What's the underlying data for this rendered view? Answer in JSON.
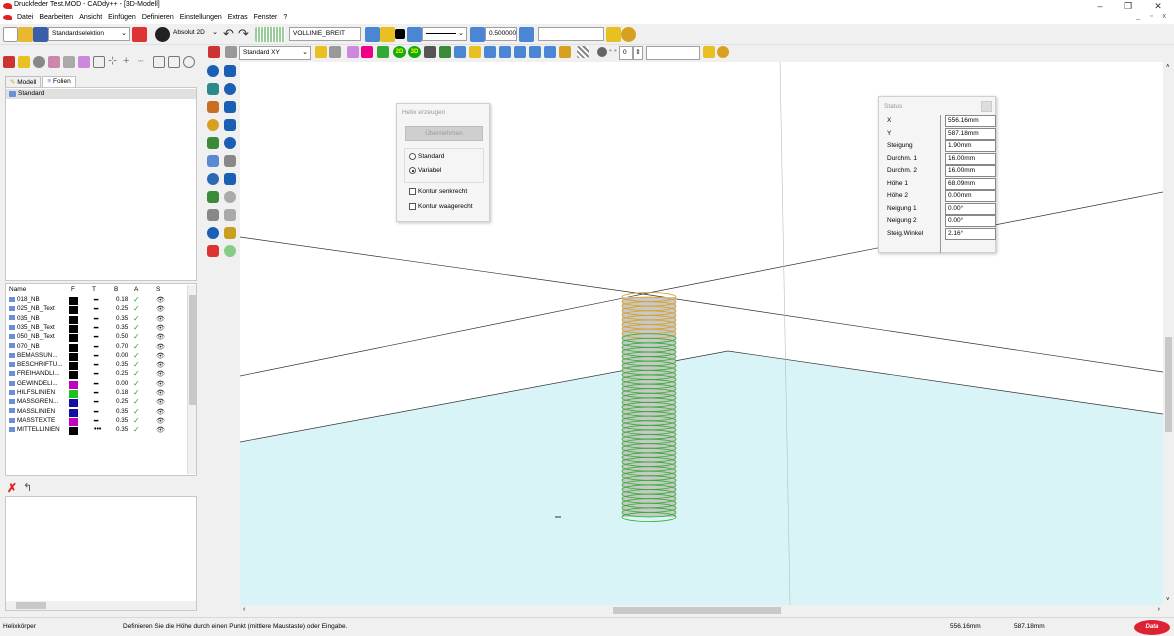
{
  "window": {
    "title": "Druckfeder Test.MOD  -  CADdy++ - [3D-Modell]",
    "minimize": "–",
    "maximize": "❐",
    "close": "✕",
    "mdi_controls": "_ ▫ x"
  },
  "menu": [
    "Datei",
    "Bearbeiten",
    "Ansicht",
    "Einfügen",
    "Definieren",
    "Einstellungen",
    "Extras",
    "Fenster",
    "?"
  ],
  "toolbar1": {
    "selection_mode": "Standardselektion",
    "coord_mode": "Absolut 2D",
    "line_style": "VOLLINIE_BREIT",
    "line_width": "0.500000",
    "extra_field": ""
  },
  "toolbar2": {
    "view": "Standard XY",
    "value": "0",
    "extra_field": "",
    "btn_2d": "2D",
    "btn_3d": "3D"
  },
  "left_panel": {
    "tabs": [
      "Modell",
      "Folien"
    ],
    "active_tab": "Folien",
    "folien": [
      "Standard"
    ],
    "layer_headers": [
      "Name",
      "F",
      "T",
      "B",
      "A",
      "S"
    ],
    "layers": [
      {
        "name": "018_NB",
        "color": "#000000",
        "line": "━",
        "b": "0.18"
      },
      {
        "name": "025_NB_Text",
        "color": "#000000",
        "line": "━",
        "b": "0.25"
      },
      {
        "name": "035_NB",
        "color": "#000000",
        "line": "━",
        "b": "0.35"
      },
      {
        "name": "035_NB_Text",
        "color": "#000000",
        "line": "━",
        "b": "0.35"
      },
      {
        "name": "050_NB_Text",
        "color": "#000000",
        "line": "━",
        "b": "0.50"
      },
      {
        "name": "070_NB",
        "color": "#000000",
        "line": "━",
        "b": "0.70"
      },
      {
        "name": "BEMASSUN...",
        "color": "#000000",
        "line": "━",
        "b": "0.00"
      },
      {
        "name": "BESCHRIFTU...",
        "color": "#000000",
        "line": "━",
        "b": "0.35"
      },
      {
        "name": "FREIHANDLI...",
        "color": "#000000",
        "line": "━",
        "b": "0.25"
      },
      {
        "name": "GEWINDELI...",
        "color": "#c000c0",
        "line": "━",
        "b": "0.00"
      },
      {
        "name": "HILFSLINIEN",
        "color": "#20c020",
        "line": "━",
        "b": "0.18"
      },
      {
        "name": "MASSGREN...",
        "color": "#1010a0",
        "line": "━",
        "b": "0.25"
      },
      {
        "name": "MASSLINIEN",
        "color": "#1010a0",
        "line": "━",
        "b": "0.35"
      },
      {
        "name": "MASSTEXTE",
        "color": "#c000c0",
        "line": "━",
        "b": "0.35"
      },
      {
        "name": "MITTELLINIEN",
        "color": "#000000",
        "line": "•••",
        "b": "0.35"
      }
    ],
    "check_glyph": "✓",
    "eye_glyph": "👁"
  },
  "helix_dialog": {
    "title": "Helix erzeugen",
    "apply_button": "Übernehmen",
    "radio_standard": "Standard",
    "radio_variabel": "Variabel",
    "selected_radio": "Variabel",
    "check_senkrecht": "Kontur senkrecht",
    "check_waagerecht": "Kontur waagerecht"
  },
  "status_dialog": {
    "title": "Status",
    "rows": [
      {
        "key": "X",
        "value": "556.16mm"
      },
      {
        "key": "Y",
        "value": "587.18mm"
      },
      {
        "key": "Steigung",
        "value": "1.90mm"
      },
      {
        "key": "Durchm. 1",
        "value": "16.00mm"
      },
      {
        "key": "Durchm. 2",
        "value": "16.00mm"
      },
      {
        "key": "Höhe 1",
        "value": "68.09mm"
      },
      {
        "key": "Höhe 2",
        "value": "0.00mm"
      },
      {
        "key": "Neigung 1",
        "value": "0.00°"
      },
      {
        "key": "Neigung 2",
        "value": "0.00°"
      },
      {
        "key": "Steig.Winkel",
        "value": "2.16°"
      }
    ]
  },
  "statusbar": {
    "mode": "Helixkörper",
    "hint": "Definieren Sie die Höhe durch einen Punkt (mittlere Maustaste) oder Eingabe.",
    "x": "556.16mm",
    "y": "587.18mm",
    "brand": "Data"
  },
  "colors": {
    "spring_fill": "#c8c8c8",
    "spring_coil_top": "#d8a020",
    "spring_coil_bottom": "#30b030",
    "floor": "#d8f4f6"
  }
}
